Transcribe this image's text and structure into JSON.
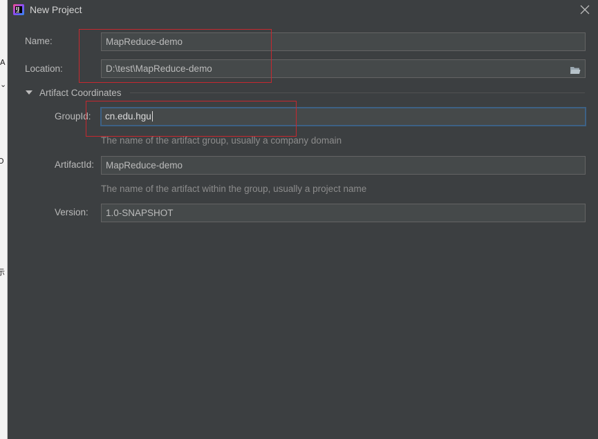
{
  "background_window": {
    "fragments": [
      "A",
      "⌄",
      "O",
      "示"
    ]
  },
  "window": {
    "title": "New Project",
    "close_icon": "close-icon",
    "app_icon": "intellij-icon"
  },
  "form": {
    "name": {
      "label": "Name:",
      "value": "MapReduce-demo"
    },
    "location": {
      "label": "Location:",
      "value": "D:\\test\\MapReduce-demo",
      "browse_icon": "folder-icon"
    },
    "artifact_section": {
      "title": "Artifact Coordinates",
      "expanded": true,
      "group_id": {
        "label": "GroupId:",
        "value": "cn.edu.hgu",
        "hint": "The name of the artifact group, usually a company domain"
      },
      "artifact_id": {
        "label": "ArtifactId:",
        "value": "MapReduce-demo",
        "hint": "The name of the artifact within the group, usually a project name"
      },
      "version": {
        "label": "Version:",
        "value": "1.0-SNAPSHOT"
      }
    }
  },
  "colors": {
    "dialog_bg": "#3c3f41",
    "field_bg": "#45494a",
    "focus_border": "#3d6185",
    "annotation_red": "#c8282f"
  }
}
